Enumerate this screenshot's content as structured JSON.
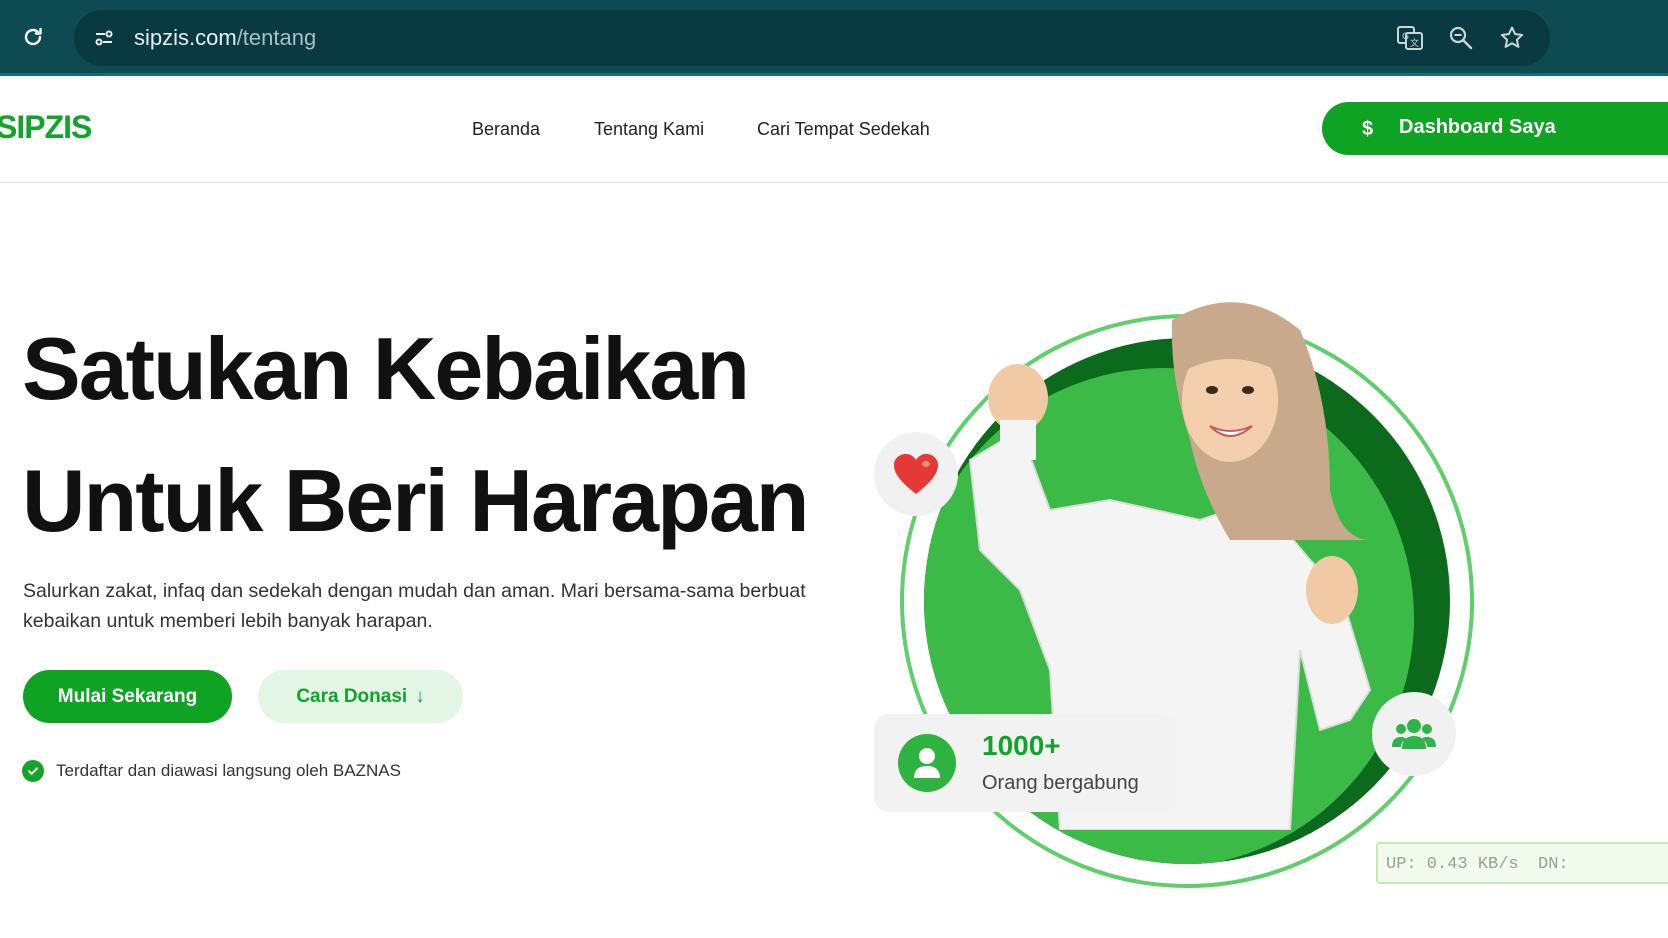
{
  "browser": {
    "url_domain": "sipzis.com",
    "url_path": "/tentang"
  },
  "site": {
    "logo": "SIPZIS",
    "nav": [
      "Beranda",
      "Tentang Kami",
      "Cari Tempat Sedekah"
    ],
    "dashboard_label": "Dashboard Saya",
    "dashboard_icon": "$"
  },
  "hero": {
    "title_line1": "Satukan Kebaikan",
    "title_line2": "Untuk Beri Harapan",
    "description": "Salurkan zakat, infaq dan sedekah dengan mudah dan aman. Mari bersama-sama berbuat kebaikan untuk memberi lebih banyak harapan.",
    "primary_button": "Mulai Sekarang",
    "secondary_button": "Cara Donasi",
    "secondary_arrow": "↓",
    "verified_text": "Terdaftar dan diawasi langsung oleh BAZNAS"
  },
  "stat": {
    "number": "1000+",
    "label": "Orang bergabung"
  },
  "netwidget": {
    "up": "UP: 0.43 KB/s",
    "dn": "DN:"
  },
  "colors": {
    "brand_green": "#0ea322",
    "browser_bar": "#0d4a52",
    "heart_red": "#e53935"
  }
}
